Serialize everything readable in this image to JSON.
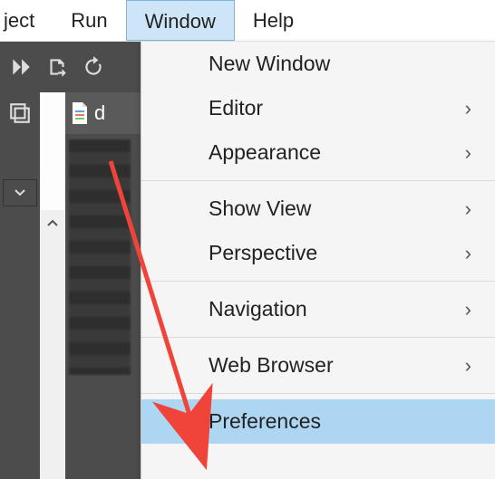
{
  "menubar": {
    "items": [
      "ject",
      "Run",
      "Window",
      "Help"
    ],
    "open_index": 2
  },
  "dropdown": {
    "items": [
      {
        "label": "New Window",
        "submenu": false,
        "highlight": false
      },
      {
        "label": "Editor",
        "submenu": true,
        "highlight": false
      },
      {
        "label": "Appearance",
        "submenu": true,
        "highlight": false
      },
      {
        "sep": true
      },
      {
        "label": "Show View",
        "submenu": true,
        "highlight": false
      },
      {
        "label": "Perspective",
        "submenu": true,
        "highlight": false
      },
      {
        "sep": true
      },
      {
        "label": "Navigation",
        "submenu": true,
        "highlight": false
      },
      {
        "sep": true
      },
      {
        "label": "Web Browser",
        "submenu": true,
        "highlight": false
      },
      {
        "sep": true
      },
      {
        "label": "Preferences",
        "submenu": false,
        "highlight": true
      }
    ]
  },
  "tab": {
    "label": "d"
  },
  "arrow_color": "#f0443a"
}
